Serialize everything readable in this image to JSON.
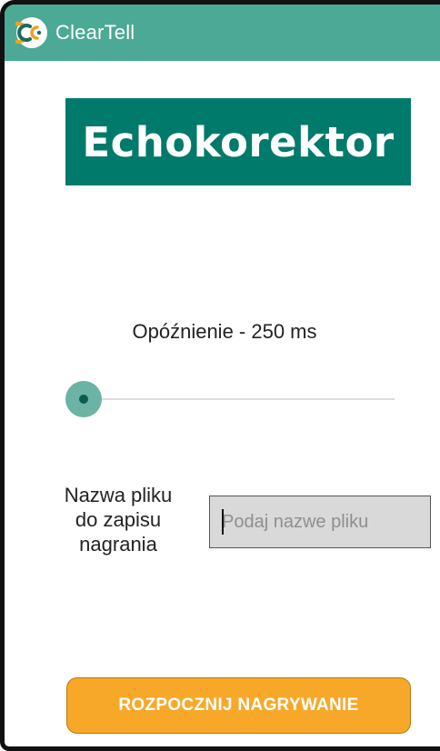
{
  "app_bar": {
    "title": "ClearTell",
    "logo_icon": "cleartell-logo-icon",
    "background_color": "#4ca996"
  },
  "banner": {
    "title": "Echokorektor",
    "background_color": "#007a6a"
  },
  "delay": {
    "label": "Opóźnienie - 250 ms",
    "slider_fraction": 0.0
  },
  "filename": {
    "label_lines": [
      "Nazwa pliku",
      "do zapisu",
      "nagrania"
    ],
    "input_value": "",
    "input_placeholder": "Podaj nazwe pliku"
  },
  "start_button": {
    "label": "ROZPOCZNIJ NAGRYWANIE",
    "color": "#f8a829"
  }
}
